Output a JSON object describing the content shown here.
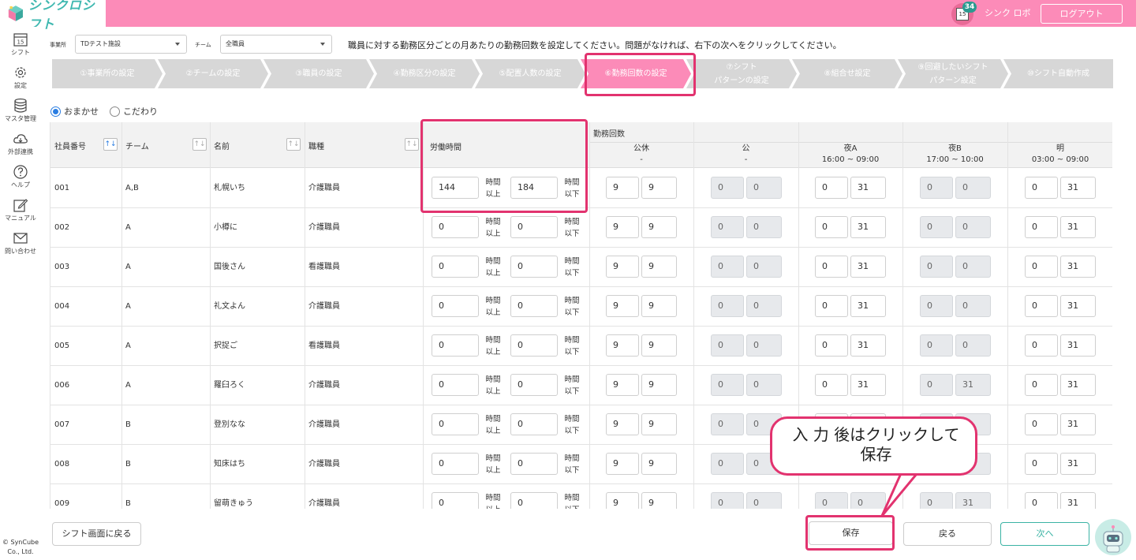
{
  "header": {
    "logo_text": "シンクロシフト",
    "calendar_day": "15",
    "notification_count": "34",
    "user_name": "シンク ロボ",
    "logout_label": "ログアウト"
  },
  "sidebar": {
    "items": [
      {
        "label": "シフト",
        "icon": "calendar-icon"
      },
      {
        "label": "設定",
        "icon": "gear-icon"
      },
      {
        "label": "マスタ管理",
        "icon": "database-icon"
      },
      {
        "label": "外部連携",
        "icon": "cloud-icon"
      },
      {
        "label": "ヘルプ",
        "icon": "question-icon"
      },
      {
        "label": "マニュアル",
        "icon": "edit-icon"
      },
      {
        "label": "問い合わせ",
        "icon": "mail-icon"
      }
    ],
    "calendar_day": "15",
    "copyright": "© SynCube Co., Ltd."
  },
  "filters": {
    "office_label": "事業所",
    "office_value": "TDテスト施設",
    "team_label": "チーム",
    "team_value": "全職員"
  },
  "instruction": "職員に対する勤務区分ごとの月あたりの勤務回数を設定してください。問題がなければ、右下の次へをクリックしてください。",
  "steps": [
    {
      "label": "①事業所の設定"
    },
    {
      "label": "②チームの設定"
    },
    {
      "label": "③職員の設定"
    },
    {
      "label": "④勤務区分の設定"
    },
    {
      "label": "⑤配置人数の設定"
    },
    {
      "label": "⑥勤務回数の設定"
    },
    {
      "label1": "⑦シフト",
      "label2": "パターンの設定"
    },
    {
      "label": "⑧組合せ設定"
    },
    {
      "label1": "⑨回避したいシフト",
      "label2": "パターン設定"
    },
    {
      "label": "⑩シフト自動作成"
    }
  ],
  "radios": {
    "auto": "おまかせ",
    "custom": "こだわり"
  },
  "table": {
    "headers": {
      "employee_no": "社員番号",
      "team": "チーム",
      "name": "名前",
      "job": "職種",
      "work_hours": "労働時間",
      "shift_counts": "勤務回数",
      "sort_symbol": "↑↓"
    },
    "shift_columns": [
      {
        "name": "公休",
        "time": "-"
      },
      {
        "name": "公",
        "time": "-"
      },
      {
        "name": "夜A",
        "time": "16:00 ~ 09:00"
      },
      {
        "name": "夜B",
        "time": "17:00 ~ 10:00"
      },
      {
        "name": "明",
        "time": "03:00 ~ 09:00"
      }
    ],
    "unit_hours": "時間",
    "unit_min": "以上",
    "unit_max": "以下",
    "rows": [
      {
        "no": "001",
        "team": "A,B",
        "name": "札幌いち",
        "job": "介護職員",
        "hmin": "144",
        "hmax": "184",
        "v": [
          [
            "9",
            "9"
          ],
          [
            "0",
            "0"
          ],
          [
            "0",
            "31"
          ],
          [
            "0",
            "0"
          ],
          [
            "0",
            "31"
          ]
        ]
      },
      {
        "no": "002",
        "team": "A",
        "name": "小樽に",
        "job": "介護職員",
        "hmin": "0",
        "hmax": "0",
        "v": [
          [
            "9",
            "9"
          ],
          [
            "0",
            "0"
          ],
          [
            "0",
            "31"
          ],
          [
            "0",
            "0"
          ],
          [
            "0",
            "31"
          ]
        ]
      },
      {
        "no": "003",
        "team": "A",
        "name": "国後さん",
        "job": "看護職員",
        "hmin": "0",
        "hmax": "0",
        "v": [
          [
            "9",
            "9"
          ],
          [
            "0",
            "0"
          ],
          [
            "0",
            "31"
          ],
          [
            "0",
            "0"
          ],
          [
            "0",
            "31"
          ]
        ]
      },
      {
        "no": "004",
        "team": "A",
        "name": "礼文よん",
        "job": "介護職員",
        "hmin": "0",
        "hmax": "0",
        "v": [
          [
            "9",
            "9"
          ],
          [
            "0",
            "0"
          ],
          [
            "0",
            "31"
          ],
          [
            "0",
            "0"
          ],
          [
            "0",
            "31"
          ]
        ]
      },
      {
        "no": "005",
        "team": "A",
        "name": "択捉ご",
        "job": "看護職員",
        "hmin": "0",
        "hmax": "0",
        "v": [
          [
            "9",
            "9"
          ],
          [
            "0",
            "0"
          ],
          [
            "0",
            "31"
          ],
          [
            "0",
            "0"
          ],
          [
            "0",
            "31"
          ]
        ]
      },
      {
        "no": "006",
        "team": "A",
        "name": "羅臼ろく",
        "job": "介護職員",
        "hmin": "0",
        "hmax": "0",
        "v": [
          [
            "9",
            "9"
          ],
          [
            "0",
            "0"
          ],
          [
            "0",
            "31"
          ],
          [
            "0",
            "31"
          ],
          [
            "0",
            "31"
          ]
        ]
      },
      {
        "no": "007",
        "team": "B",
        "name": "登別なな",
        "job": "介護職員",
        "hmin": "0",
        "hmax": "0",
        "v": [
          [
            "9",
            "9"
          ],
          [
            "0",
            "0"
          ],
          [
            "",
            ""
          ],
          [
            "",
            ""
          ],
          [
            "0",
            "31"
          ]
        ]
      },
      {
        "no": "008",
        "team": "B",
        "name": "知床はち",
        "job": "介護職員",
        "hmin": "0",
        "hmax": "0",
        "v": [
          [
            "9",
            "9"
          ],
          [
            "0",
            "0"
          ],
          [
            "",
            ""
          ],
          [
            "",
            ""
          ],
          [
            "0",
            "31"
          ]
        ]
      },
      {
        "no": "009",
        "team": "B",
        "name": "留萌きゅう",
        "job": "介護職員",
        "hmin": "0",
        "hmax": "0",
        "v": [
          [
            "9",
            "9"
          ],
          [
            "0",
            "0"
          ],
          [
            "0",
            "0"
          ],
          [
            "0",
            "31"
          ],
          [
            "0",
            "31"
          ]
        ]
      }
    ]
  },
  "buttons": {
    "back_to_shift": "シフト画面に戻る",
    "save": "保存",
    "back": "戻る",
    "next": "次へ"
  },
  "callout": {
    "line1": "入 力 後はクリックして",
    "line2": "保存"
  },
  "colors": {
    "brand_pink": "#fc8bb8",
    "highlight": "#e2336f",
    "teal": "#3bb3a4",
    "radio_blue": "#2a7de1"
  }
}
